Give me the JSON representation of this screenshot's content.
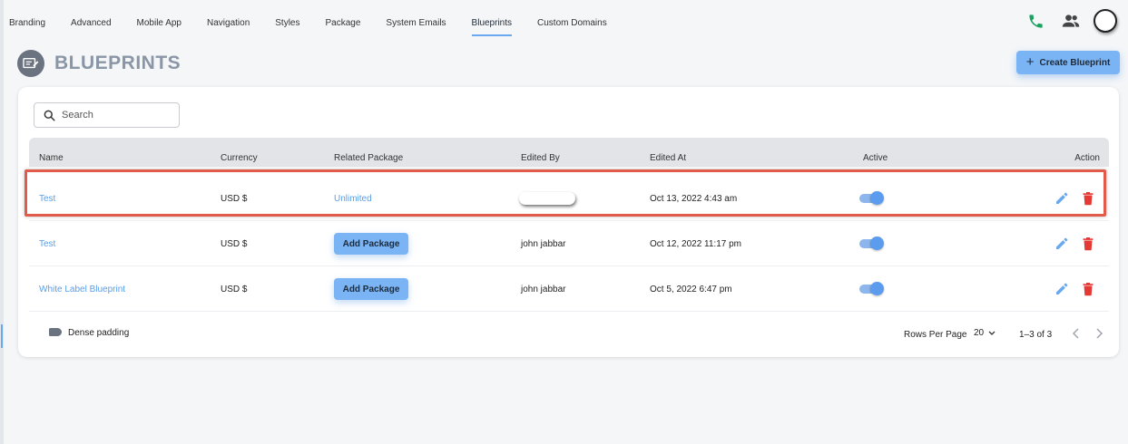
{
  "nav": {
    "tabs": [
      {
        "label": "Branding"
      },
      {
        "label": "Advanced"
      },
      {
        "label": "Mobile App"
      },
      {
        "label": "Navigation"
      },
      {
        "label": "Styles"
      },
      {
        "label": "Package"
      },
      {
        "label": "System Emails"
      },
      {
        "label": "Blueprints"
      },
      {
        "label": "Custom Domains"
      }
    ],
    "active_tab": "Blueprints"
  },
  "header": {
    "title": "BLUEPRINTS",
    "create_label": "Create Blueprint",
    "create_icon": "plus-icon"
  },
  "search": {
    "placeholder": "Search",
    "value": ""
  },
  "table": {
    "columns": [
      "Name",
      "Currency",
      "Related Package",
      "Edited By",
      "Edited At",
      "Active",
      "Action"
    ],
    "rows": [
      {
        "name": "Test",
        "currency": "USD $",
        "related_package": "Unlimited",
        "edited_by": "",
        "edited_at": "Oct 13, 2022 4:43 am",
        "active": true
      },
      {
        "name": "Test",
        "currency": "USD $",
        "related_package_button": "Add Package",
        "edited_by": "john jabbar",
        "edited_at": "Oct 12, 2022 11:17 pm",
        "active": true
      },
      {
        "name": "White Label Blueprint",
        "currency": "USD $",
        "related_package_button": "Add Package",
        "edited_by": "john jabbar",
        "edited_at": "Oct 5, 2022 6:47 pm",
        "active": true
      }
    ]
  },
  "footer": {
    "dense_label": "Dense padding",
    "rows_per_page_label": "Rows Per Page",
    "rows_per_page_value": "20",
    "range": "1–3 of 3"
  },
  "colors": {
    "accent": "#7ab4f5",
    "link": "#5a9ee8",
    "phone": "#1aa260",
    "delete": "#e53935",
    "highlight": "#e25a4a"
  }
}
